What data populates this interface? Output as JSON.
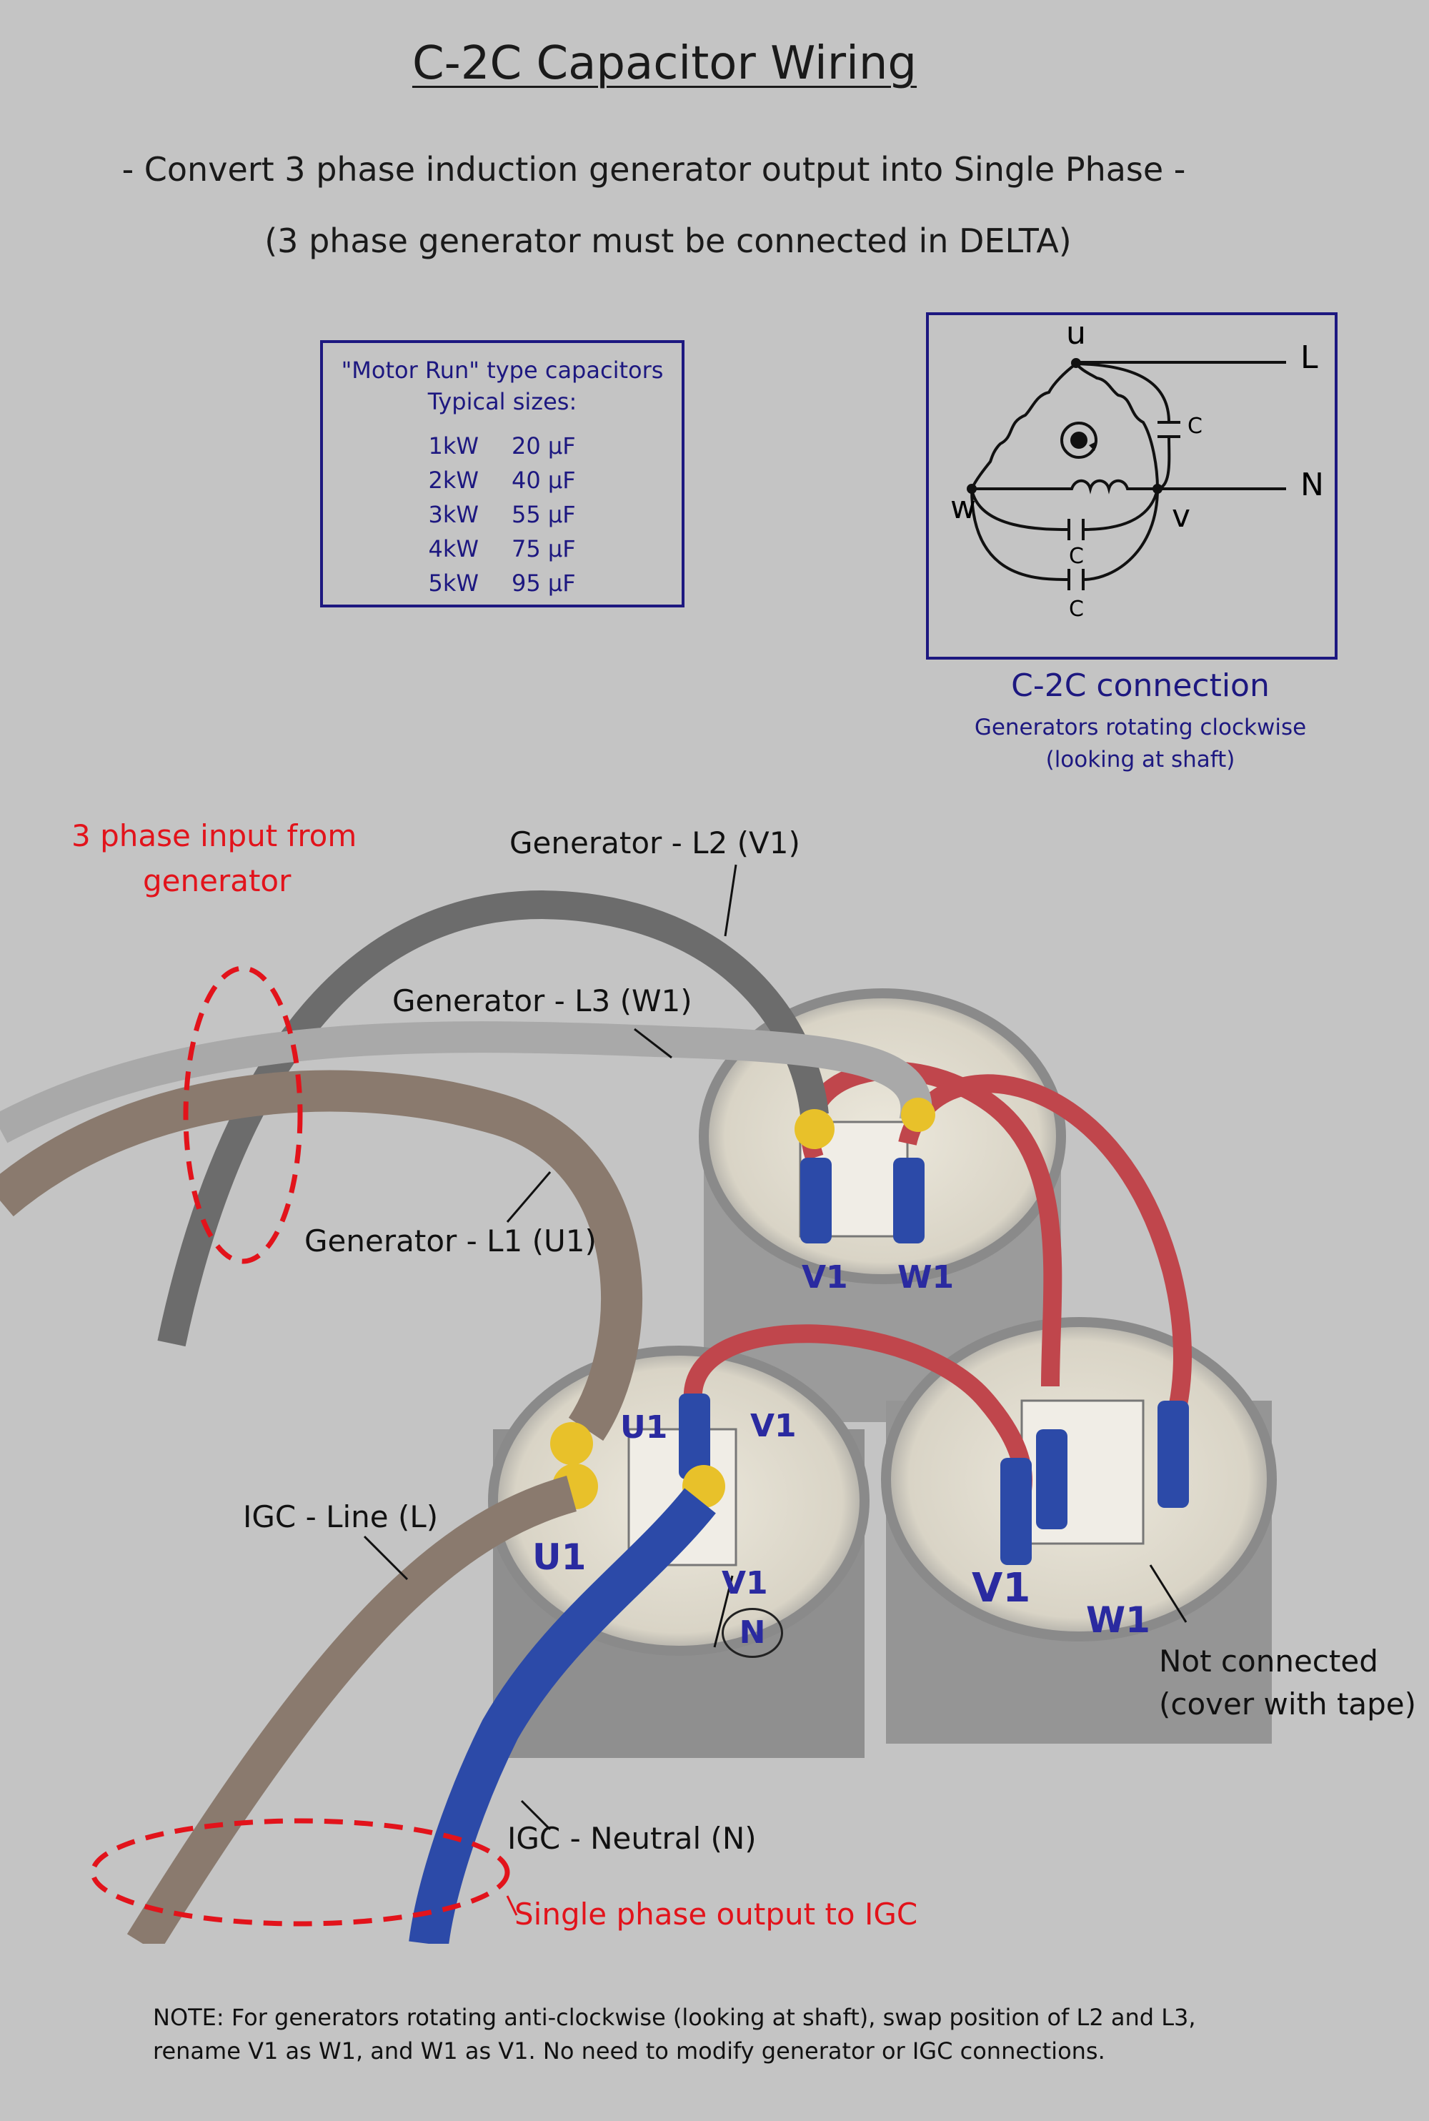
{
  "title": "C-2C Capacitor Wiring",
  "subtitle": "- Convert 3 phase induction generator output into Single Phase -",
  "subtitle2": "(3 phase generator must be connected in DELTA)",
  "capacitor_box": {
    "heading1": "\"Motor Run\" type capacitors",
    "heading2": "Typical sizes:",
    "rows": [
      {
        "kw": "1kW",
        "uf": "20 µF"
      },
      {
        "kw": "2kW",
        "uf": "40 µF"
      },
      {
        "kw": "3kW",
        "uf": "55 µF"
      },
      {
        "kw": "4kW",
        "uf": "75 µF"
      },
      {
        "kw": "5kW",
        "uf": "95 µF"
      }
    ]
  },
  "schematic": {
    "node_u": "u",
    "node_v": "v",
    "node_w": "w",
    "out_L": "L",
    "out_N": "N",
    "cap_label": "C"
  },
  "connection_caption": "C-2C connection",
  "connection_sub1": "Generators rotating clockwise",
  "connection_sub2": "(looking at shaft)",
  "photo_labels": {
    "input_1": "3 phase input from",
    "input_2": "generator",
    "l2": "Generator - L2 (V1)",
    "l3": "Generator - L3 (W1)",
    "l1": "Generator - L1 (U1)",
    "igc_line": "IGC - Line (L)",
    "igc_neutral": "IGC - Neutral (N)",
    "output": "Single phase output to IGC",
    "not_connected_1": "Not connected",
    "not_connected_2": "(cover with tape)",
    "marks": {
      "v1": "V1",
      "w1": "W1",
      "u1": "U1",
      "n": "N"
    }
  },
  "note_1": "NOTE: For generators rotating anti-clockwise (looking at shaft), swap position of L2 and L3,",
  "note_2": "rename V1 as W1, and W1 as V1. No need to modify generator or IGC connections.",
  "colors": {
    "background": "#c4c4c4",
    "navy": "#1d1880",
    "red": "#e2131b",
    "marker_blue": "#2a2aa0",
    "wire_red": "#c0464c",
    "wire_brown": "#8a7a6e",
    "wire_grey_dark": "#6c6c6c",
    "wire_grey_light": "#a9a9a9",
    "wire_blue": "#2c4aa8",
    "terminal_yellow": "#e8c12a"
  }
}
